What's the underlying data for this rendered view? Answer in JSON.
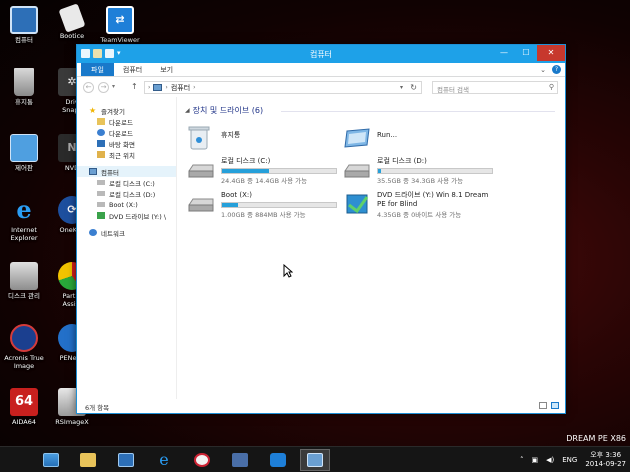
{
  "desktop": {
    "icons": [
      {
        "name": "computer",
        "label": "컴퓨터"
      },
      {
        "name": "bootice",
        "label": "Bootice"
      },
      {
        "name": "teamviewer",
        "label": "TeamViewer"
      },
      {
        "name": "recycle-bin",
        "label": "휴지통"
      },
      {
        "name": "drive-snapshot",
        "label": "Driv\nSnaps"
      },
      {
        "name": "control-panel",
        "label": "제어판"
      },
      {
        "name": "nvda",
        "label": "NVD"
      },
      {
        "name": "internet-explorer",
        "label": "Internet\nExplorer"
      },
      {
        "name": "onekey",
        "label": "OneKey"
      },
      {
        "name": "disk-management",
        "label": "디스크 관리"
      },
      {
        "name": "partition-assistant",
        "label": "Partiti\nAssist"
      },
      {
        "name": "acronis",
        "label": "Acronis True\nImage"
      },
      {
        "name": "penet",
        "label": "PENetw"
      },
      {
        "name": "aida64",
        "label": "AIDA64"
      },
      {
        "name": "rsimagex",
        "label": "RSImageX"
      }
    ],
    "aida_badge": "64",
    "watermark": "DREAM PE X86"
  },
  "window": {
    "title": "컴퓨터",
    "controls": {
      "minimize": "—",
      "maximize": "☐",
      "close": "✕"
    },
    "ribbon_tabs": [
      {
        "label": "파일"
      },
      {
        "label": "컴퓨터"
      },
      {
        "label": "보기"
      }
    ],
    "ribbon_chevron": "⌄",
    "help_label": "?",
    "address": {
      "path": "컴퓨터",
      "separator": "›"
    },
    "search": {
      "placeholder": "컴퓨터 검색"
    },
    "nav_pane": {
      "favorites": {
        "label": "즐겨찾기",
        "items": [
          "다운로드",
          "다운로드",
          "바탕 화면",
          "최근 위치"
        ]
      },
      "computer": {
        "label": "컴퓨터",
        "items": [
          "로컬 디스크 (C:)",
          "로컬 디스크 (D:)",
          "Boot (X:)",
          "DVD 드라이브 (Y:) \\"
        ]
      },
      "network": {
        "label": "네트워크"
      }
    },
    "group": {
      "title": "장치 및 드라이브 (6)"
    },
    "items": [
      {
        "name": "휴지통",
        "type": "recycle"
      },
      {
        "name": "Run...",
        "type": "run"
      },
      {
        "name": "로컬 디스크 (C:)",
        "type": "disk",
        "used_fraction": 0.41,
        "free": "24.4GB 중 14.4GB 사용 가능"
      },
      {
        "name": "로컬 디스크 (D:)",
        "type": "disk",
        "used_fraction": 0.03,
        "free": "35.5GB 중 34.3GB 사용 가능"
      },
      {
        "name": "Boot (X:)",
        "type": "disk",
        "used_fraction": 0.14,
        "free": "1.00GB 중 884MB 사용 가능"
      },
      {
        "name": "DVD 드라이브 (Y:) Win 8.1 Dream\nPE for Blind",
        "type": "dvd",
        "free": "4.35GB 중 0바이트 사용 가능"
      }
    ],
    "status": {
      "count": "6개 항목"
    }
  },
  "taskbar": {
    "apps": [
      "start",
      "file-explorer-pinned",
      "desktop",
      "internet-explorer",
      "magnifier",
      "network",
      "teamviewer",
      "computer-window"
    ],
    "tray": {
      "chevron": "˄",
      "lang": "ENG",
      "time": "오후 3:36",
      "date": "2014-09-27"
    }
  },
  "colors": {
    "accent": "#1ea1e8",
    "progress": "#26a0da",
    "close": "#c7382d"
  }
}
